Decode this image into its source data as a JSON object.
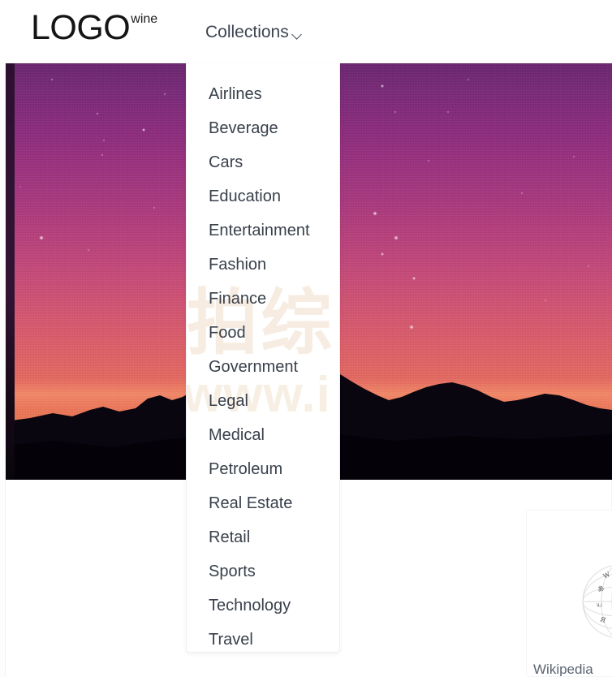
{
  "header": {
    "brand": {
      "main": "LOGO",
      "sub": "wine"
    },
    "nav": {
      "collections_label": "Collections",
      "chevron_icon": "chevron-down-icon"
    }
  },
  "dropdown": {
    "open": true,
    "items": [
      {
        "label": "Airlines"
      },
      {
        "label": "Beverage"
      },
      {
        "label": "Cars"
      },
      {
        "label": "Education"
      },
      {
        "label": "Entertainment"
      },
      {
        "label": "Fashion"
      },
      {
        "label": "Finance"
      },
      {
        "label": "Food"
      },
      {
        "label": "Government"
      },
      {
        "label": "Legal"
      },
      {
        "label": "Medical"
      },
      {
        "label": "Petroleum"
      },
      {
        "label": "Real Estate"
      },
      {
        "label": "Retail"
      },
      {
        "label": "Sports"
      },
      {
        "label": "Technology"
      },
      {
        "label": "Travel"
      }
    ]
  },
  "watermark": {
    "cjk_text": "拍综",
    "url_text": "www.i"
  },
  "hero": {
    "alt": "purple and orange twilight sky with stars over a dark mountain ridge"
  },
  "wiki_card": {
    "caption": "Wikipedia",
    "logo_icon": "wikipedia-globe-icon"
  },
  "colors": {
    "page_bg": "#ffffff",
    "text_primary": "#39404b",
    "brand_text": "#151515",
    "nav_text": "#3c4450",
    "panel_border": "#eceef0",
    "watermark": "#f7ece1",
    "sky_top": "#6d2a72",
    "sky_mid": "#c44d7c",
    "sky_horizon": "#e87a59",
    "ridge": "#090610"
  }
}
